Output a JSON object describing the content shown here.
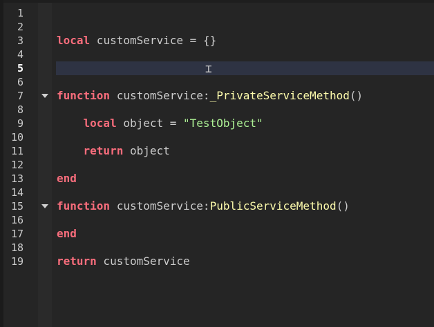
{
  "editor": {
    "current_line": 5,
    "line_numbers": [
      "1",
      "2",
      "3",
      "4",
      "5",
      "6",
      "7",
      "8",
      "9",
      "10",
      "11",
      "12",
      "13",
      "14",
      "15",
      "16",
      "17",
      "18",
      "19"
    ],
    "folds": [
      7,
      15
    ],
    "lines": [
      [],
      [],
      [
        {
          "t": "local",
          "c": "kw"
        },
        {
          "t": " customService = {}",
          "c": ""
        }
      ],
      [],
      [],
      [],
      [
        {
          "t": "function",
          "c": "kw"
        },
        {
          "t": " customService:",
          "c": ""
        },
        {
          "t": "_PrivateServiceMethod",
          "c": "fn"
        },
        {
          "t": "()",
          "c": ""
        }
      ],
      [],
      [
        {
          "t": "    ",
          "c": ""
        },
        {
          "t": "local",
          "c": "kw"
        },
        {
          "t": " object = ",
          "c": ""
        },
        {
          "t": "\"TestObject\"",
          "c": "str"
        }
      ],
      [],
      [
        {
          "t": "    ",
          "c": ""
        },
        {
          "t": "return",
          "c": "kw"
        },
        {
          "t": " object",
          "c": ""
        }
      ],
      [],
      [
        {
          "t": "end",
          "c": "kw"
        }
      ],
      [],
      [
        {
          "t": "function",
          "c": "kw"
        },
        {
          "t": " customService:",
          "c": ""
        },
        {
          "t": "PublicServiceMethod",
          "c": "fn"
        },
        {
          "t": "()",
          "c": ""
        }
      ],
      [],
      [
        {
          "t": "end",
          "c": "kw"
        }
      ],
      [],
      [
        {
          "t": "return",
          "c": "kw"
        },
        {
          "t": " customService",
          "c": ""
        }
      ]
    ]
  }
}
